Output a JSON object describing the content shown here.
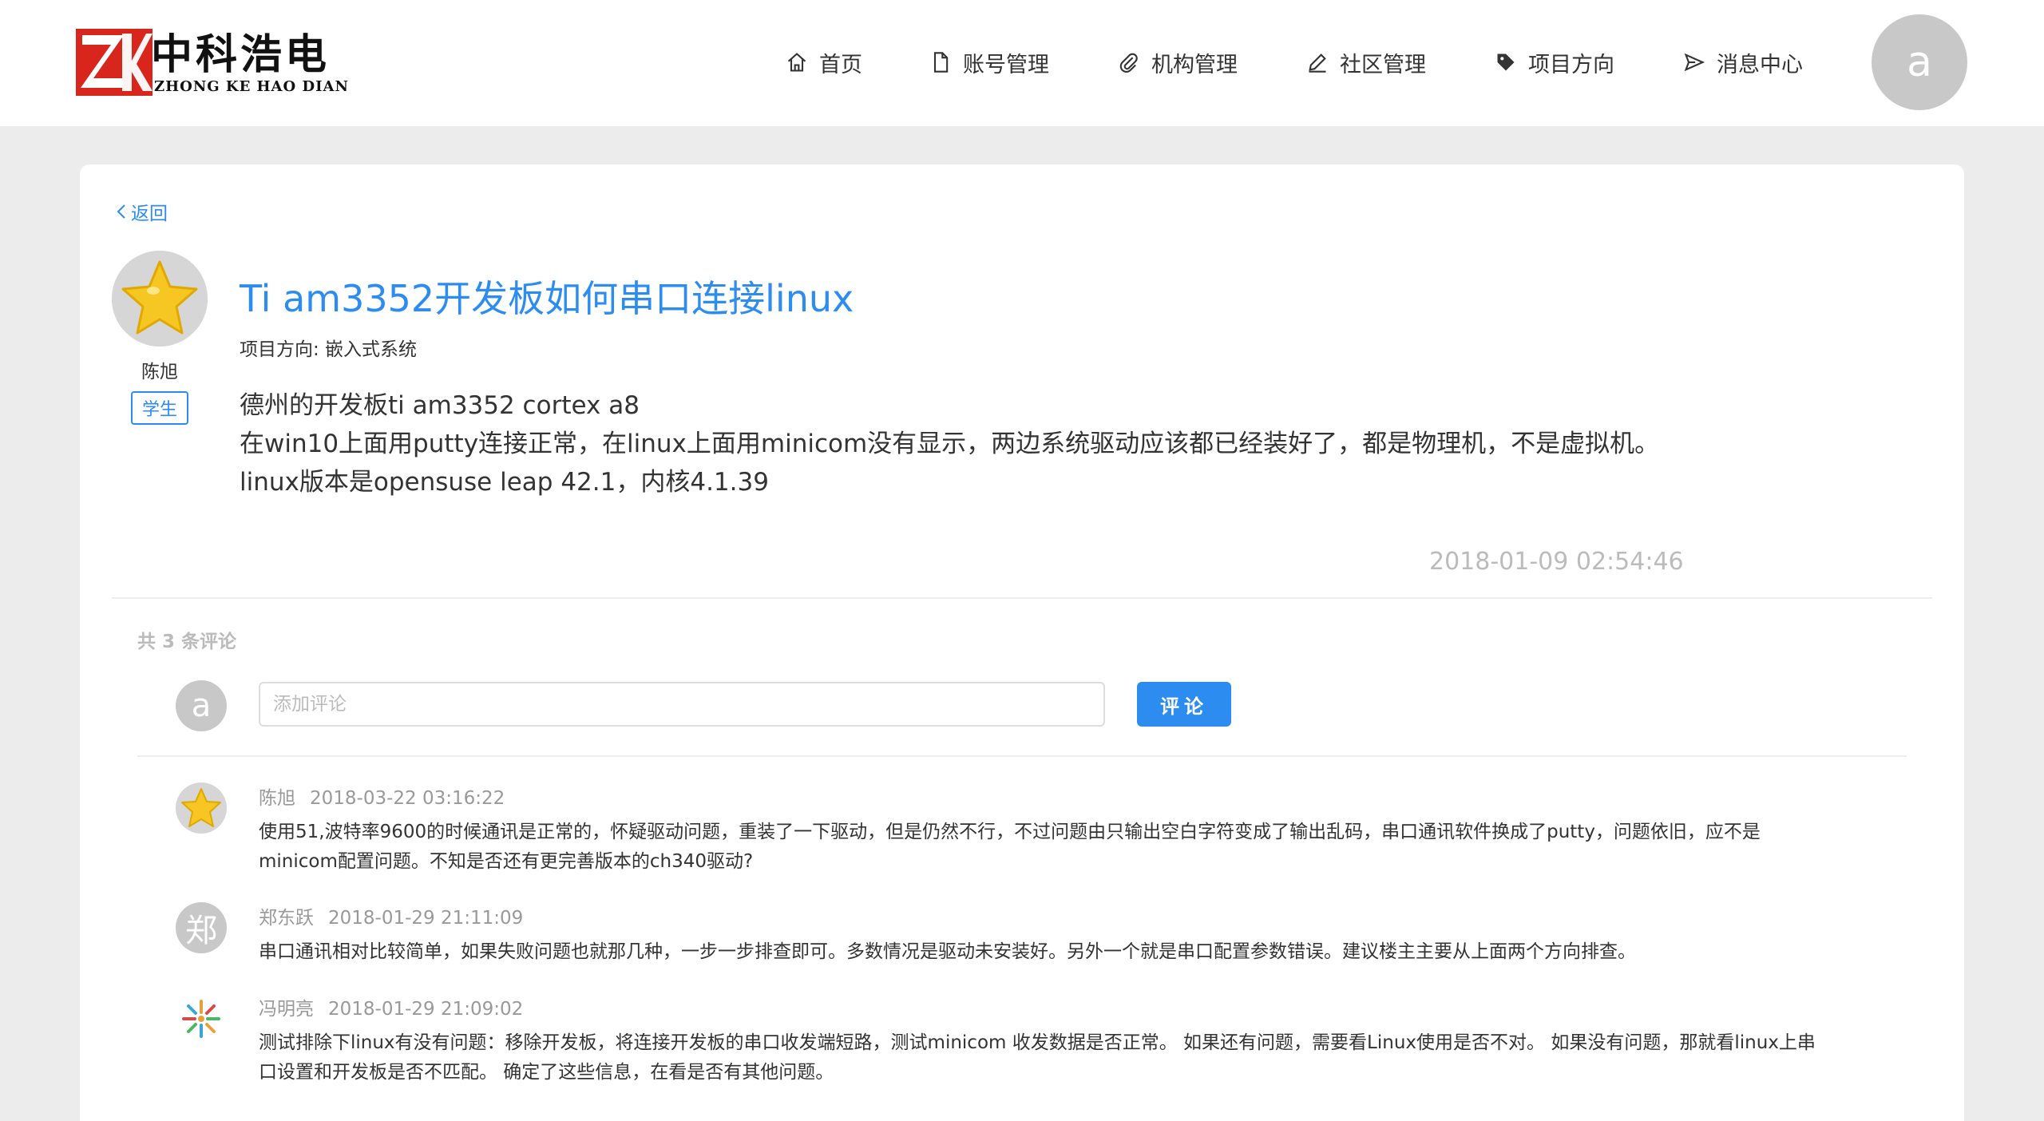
{
  "brand": {
    "name_cn": "中科浩电",
    "name_en": "ZHONG KE HAO DIAN",
    "colors": {
      "red": "#d9261c",
      "accent": "#2d8cf0"
    }
  },
  "nav": [
    {
      "label": "首页",
      "icon": "home-icon"
    },
    {
      "label": "账号管理",
      "icon": "document-icon"
    },
    {
      "label": "机构管理",
      "icon": "paperclip-icon"
    },
    {
      "label": "社区管理",
      "icon": "pencil-icon"
    },
    {
      "label": "项目方向",
      "icon": "tag-icon"
    },
    {
      "label": "消息中心",
      "icon": "send-icon"
    }
  ],
  "user": {
    "initial": "a"
  },
  "back_label": "返回",
  "post": {
    "author_name": "陈旭",
    "author_role": "学生",
    "title": "Ti am3352开发板如何串口连接linux",
    "direction": "项目方向: 嵌入式系统",
    "body": [
      "德州的开发板ti am3352 cortex a8",
      "在win10上面用putty连接正常，在linux上面用minicom没有显示，两边系统驱动应该都已经装好了，都是物理机，不是虚拟机。",
      "linux版本是opensuse leap 42.1，内核4.1.39"
    ],
    "time": "2018-01-09 02:54:46"
  },
  "comments_section": {
    "count_label": "共 3 条评论",
    "input_placeholder": "添加评论",
    "submit_label": "评论"
  },
  "comments": [
    {
      "name": "陈旭",
      "time": "2018-03-22 03:16:22",
      "avatar": "star-avatar",
      "text": [
        "使用51,波特率9600的时候通讯是正常的，怀疑驱动问题，重装了一下驱动，但是仍然不行，不过问题由只输出空白字符变成了输出乱码，串口通讯软件换成了putty，问题依旧，应不是",
        "minicom配置问题。不知是否还有更完善版本的ch340驱动?"
      ]
    },
    {
      "name": "郑东跃",
      "time": "2018-01-29 21:11:09",
      "avatar_char": "郑",
      "text": [
        "串口通讯相对比较简单，如果失败问题也就那几种，一步一步排查即可。多数情况是驱动未安装好。另外一个就是串口配置参数错误。建议楼主主要从上面两个方向排查。"
      ]
    },
    {
      "name": "冯明亮",
      "time": "2018-01-29 21:09:02",
      "avatar": "pattern-avatar",
      "text": [
        "测试排除下linux有没有问题：移除开发板，将连接开发板的串口收发端短路，测试minicom 收发数据是否正常。 如果还有问题，需要看Linux使用是否不对。 如果没有问题，那就看linux上串",
        "口设置和开发板是否不匹配。 确定了这些信息，在看是否有其他问题。"
      ]
    }
  ]
}
